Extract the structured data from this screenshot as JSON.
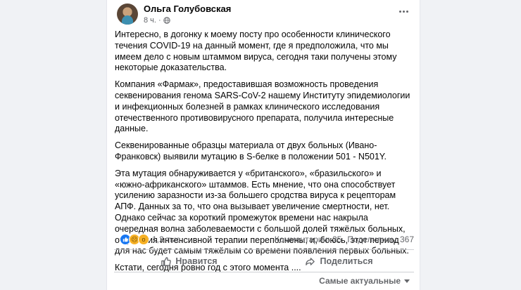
{
  "post": {
    "author": "Ольга Голубовская",
    "time": "8 ч.",
    "dot": "·",
    "paragraphs": [
      "Интересно, в догонку к моему посту про особенности клинического течения COVID-19 на данный момент, где я предположила, что мы имеем дело с новым штаммом вируса, сегодня таки получены этому некоторые доказательства.",
      "Компания «Фармак», предоставившая возможность проведения секвенирования генома SARS-CoV-2 нашему Институту эпидемиологии и инфекционных болезней в рамках клинического исследования отечественного противовирусного препарата, получила интересные данные.",
      "Секвенированные образцы материала от двух больных (Ивано-Франковск) выявили мутацию в S-белке в положении 501 - N501Y.",
      "Эта мутация обнаруживается у «британского», «бразильского» и «южно-африканского» штаммов.  Есть мнение, что она способствует усилению заразности из-за большего сродства вируса к рецепторам АПФ. Данных за то, что она вызывает увеличение смертности, нет. Однако сейчас за короткий промежуток времени нас накрыла очередная волна заболеваемости с большой долей тяжёлых больных, отделения интенсивной терапии переполнены, и, боюсь, этот период для нас будет самым тяжёлым со времени появления первых больных.",
      "Кстати, сегодня ровно год с этого момента ...."
    ]
  },
  "stats": {
    "reactions_count": "1,2 тыс.",
    "reaction_icons": [
      "like-icon",
      "sad-icon",
      "wow-icon"
    ],
    "comments": "Комментарии: 25",
    "shares": "Поделились: 367"
  },
  "actions": {
    "like_label": "Нравится",
    "share_label": "Поделиться"
  },
  "sort": {
    "label": "Самые актуальные"
  },
  "colors": {
    "background": "#f0f2f5",
    "card": "#ffffff",
    "text": "#050505",
    "secondary_text": "#65676b",
    "like_blue": "#1877f2",
    "reaction_yellow": "#f7b125"
  }
}
